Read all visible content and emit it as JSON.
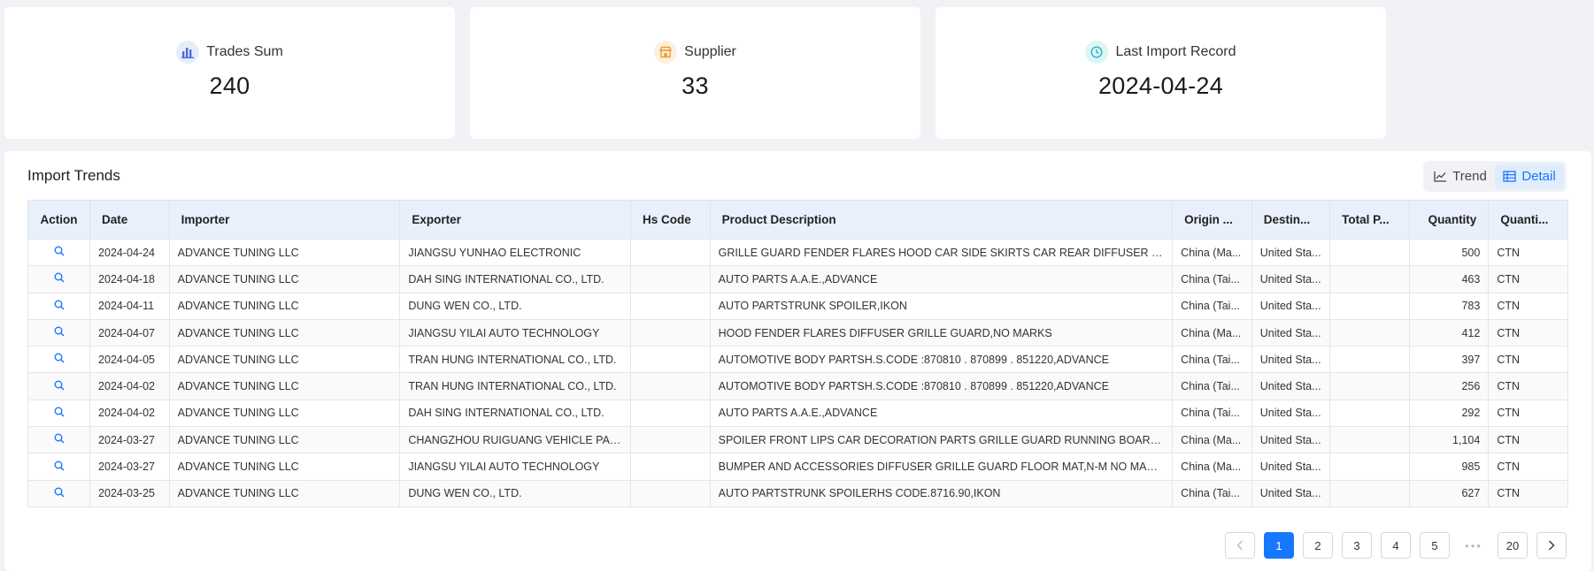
{
  "stats": [
    {
      "label": "Trades Sum",
      "value": "240",
      "icon": "bar-chart-icon",
      "color": "#4b6bd6",
      "bg": "#e6ecfb"
    },
    {
      "label": "Supplier",
      "value": "33",
      "icon": "store-icon",
      "color": "#f29a2e",
      "bg": "#fdf0df"
    },
    {
      "label": "Last Import Record",
      "value": "2024-04-24",
      "icon": "clock-icon",
      "color": "#27b7c4",
      "bg": "#def5f7"
    }
  ],
  "panel": {
    "title": "Import Trends",
    "toggle": {
      "trend": "Trend",
      "detail": "Detail",
      "active": "detail"
    }
  },
  "table": {
    "columns": [
      "Action",
      "Date",
      "Importer",
      "Exporter",
      "Hs Code",
      "Product Description",
      "Origin ...",
      "Destin...",
      "Total P...",
      "Quantity",
      "Quanti..."
    ],
    "rows": [
      [
        "2024-04-24",
        "ADVANCE TUNING LLC",
        "JIANGSU YUNHAO ELECTRONIC",
        "",
        "GRILLE GUARD FENDER FLARES HOOD CAR SIDE SKIRTS CAR REAR DIFFUSER CAR...",
        "China (Ma...",
        "United Sta...",
        "",
        "500",
        "CTN"
      ],
      [
        "2024-04-18",
        "ADVANCE TUNING LLC",
        "DAH SING INTERNATIONAL CO., LTD.",
        "",
        "AUTO PARTS A.A.E.,ADVANCE",
        "China (Tai...",
        "United Sta...",
        "",
        "463",
        "CTN"
      ],
      [
        "2024-04-11",
        "ADVANCE TUNING LLC",
        "DUNG WEN CO., LTD.",
        "",
        "AUTO PARTSTRUNK SPOILER,IKON",
        "China (Tai...",
        "United Sta...",
        "",
        "783",
        "CTN"
      ],
      [
        "2024-04-07",
        "ADVANCE TUNING LLC",
        "JIANGSU YILAI AUTO TECHNOLOGY",
        "",
        "HOOD FENDER FLARES DIFFUSER GRILLE GUARD,NO MARKS",
        "China (Ma...",
        "United Sta...",
        "",
        "412",
        "CTN"
      ],
      [
        "2024-04-05",
        "ADVANCE TUNING LLC",
        "TRAN HUNG INTERNATIONAL CO., LTD.",
        "",
        "AUTOMOTIVE BODY PARTSH.S.CODE :870810 . 870899 . 851220,ADVANCE",
        "China (Tai...",
        "United Sta...",
        "",
        "397",
        "CTN"
      ],
      [
        "2024-04-02",
        "ADVANCE TUNING LLC",
        "TRAN HUNG INTERNATIONAL CO., LTD.",
        "",
        "AUTOMOTIVE BODY PARTSH.S.CODE :870810 . 870899 . 851220,ADVANCE",
        "China (Tai...",
        "United Sta...",
        "",
        "256",
        "CTN"
      ],
      [
        "2024-04-02",
        "ADVANCE TUNING LLC",
        "DAH SING INTERNATIONAL CO., LTD.",
        "",
        "AUTO PARTS A.A.E.,ADVANCE",
        "China (Tai...",
        "United Sta...",
        "",
        "292",
        "CTN"
      ],
      [
        "2024-03-27",
        "ADVANCE TUNING LLC",
        "CHANGZHOU RUIGUANG VEHICLE PARTS",
        "",
        "SPOILER FRONT LIPS CAR DECORATION PARTS GRILLE GUARD RUNNING BOARD,N...",
        "China (Ma...",
        "United Sta...",
        "",
        "1,104",
        "CTN"
      ],
      [
        "2024-03-27",
        "ADVANCE TUNING LLC",
        "JIANGSU YILAI AUTO TECHNOLOGY",
        "",
        "BUMPER AND ACCESSORIES DIFFUSER GRILLE GUARD FLOOR MAT,N-M NO MARKS",
        "China (Ma...",
        "United Sta...",
        "",
        "985",
        "CTN"
      ],
      [
        "2024-03-25",
        "ADVANCE TUNING LLC",
        "DUNG WEN CO., LTD.",
        "",
        "AUTO PARTSTRUNK SPOILERHS CODE.8716.90,IKON",
        "China (Tai...",
        "United Sta...",
        "",
        "627",
        "CTN"
      ]
    ]
  },
  "pagination": {
    "pages": [
      "1",
      "2",
      "3",
      "4",
      "5"
    ],
    "ellipsis": "•••",
    "last": "20",
    "current": "1"
  },
  "colors": {
    "accent": "#1677ff",
    "header_bg": "#e9f0fc"
  }
}
